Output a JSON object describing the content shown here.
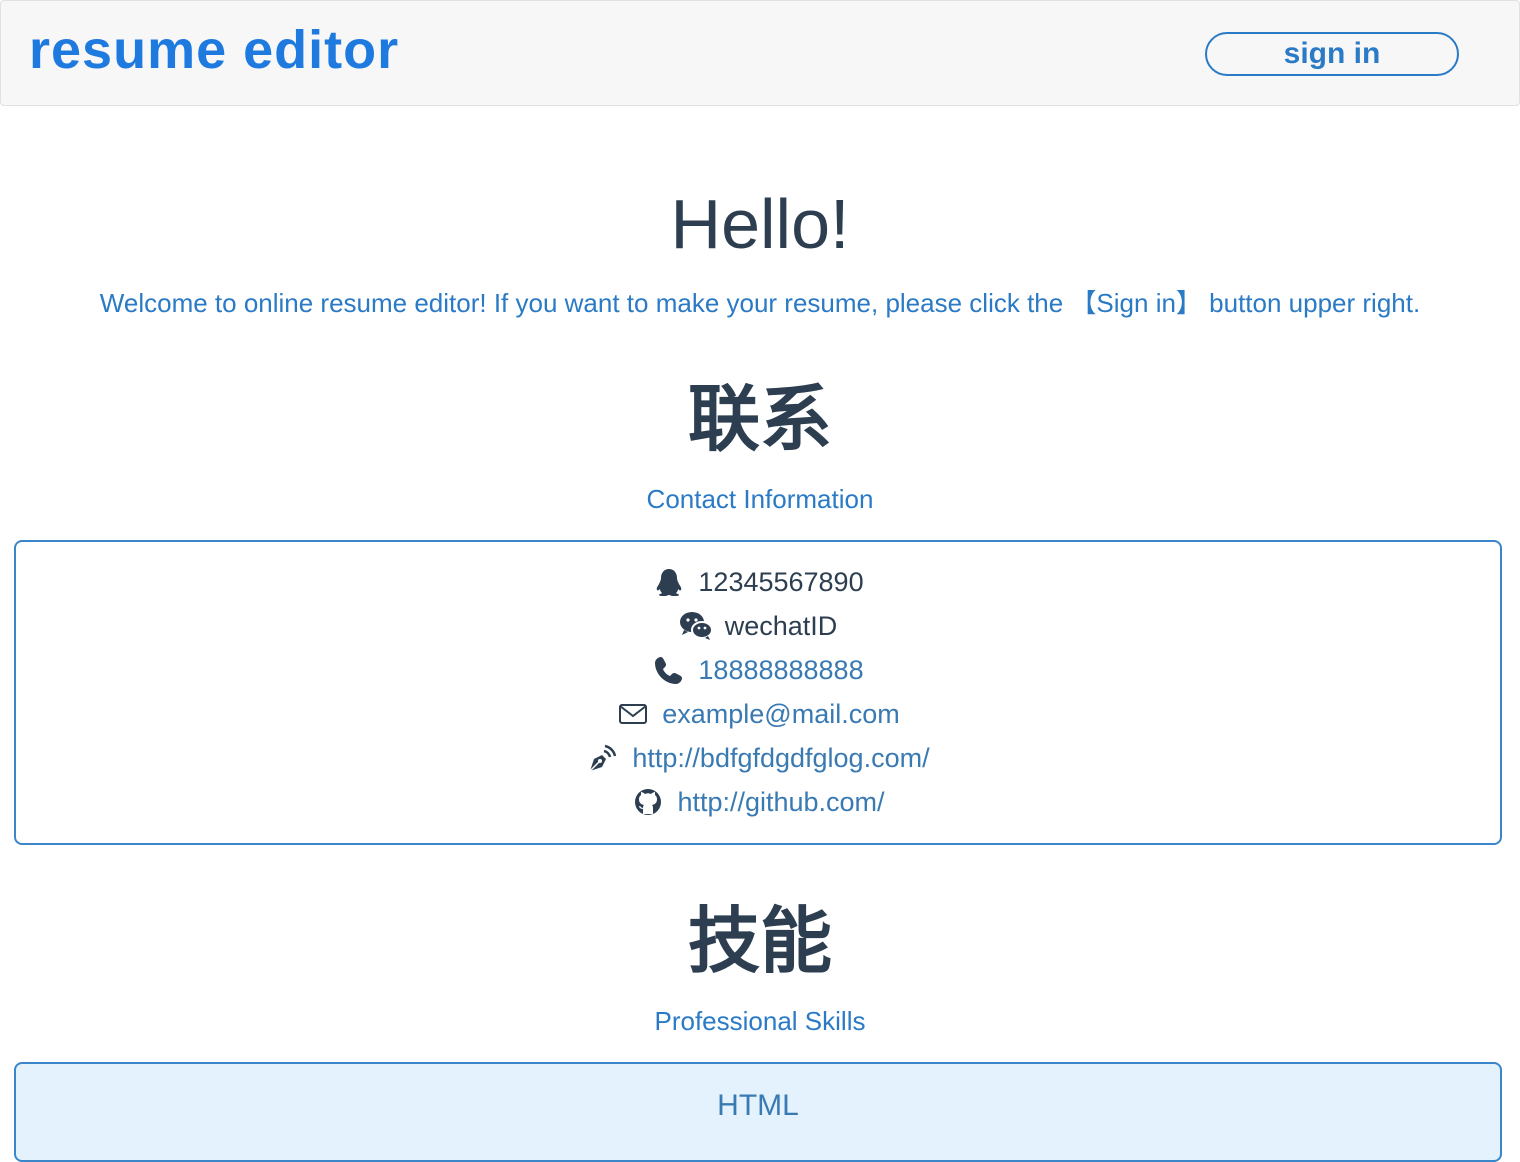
{
  "header": {
    "brand": "resume editor",
    "signin_label": "sign in"
  },
  "intro": {
    "greeting": "Hello!",
    "welcome": "Welcome to online resume editor! If you want to make your resume, please click the 【Sign in】 button upper right."
  },
  "contact": {
    "title": "联系",
    "subtitle": "Contact Information",
    "items": [
      {
        "icon": "qq-icon",
        "value": "12345567890"
      },
      {
        "icon": "wechat-icon",
        "value": "wechatID"
      },
      {
        "icon": "phone-icon",
        "value": "18888888888"
      },
      {
        "icon": "mail-icon",
        "value": "example@mail.com"
      },
      {
        "icon": "blog-pen-icon",
        "value": "http://bdfgfdgdfglog.com/"
      },
      {
        "icon": "github-icon",
        "value": "http://github.com/"
      }
    ]
  },
  "skills": {
    "title": "技能",
    "subtitle": "Professional Skills",
    "items": [
      {
        "name": "HTML"
      }
    ]
  },
  "colors": {
    "brand": "#1f7ae0",
    "accent": "#2a7ac6",
    "text": "#2c3e50",
    "skill_bg": "#e3f2fc"
  }
}
